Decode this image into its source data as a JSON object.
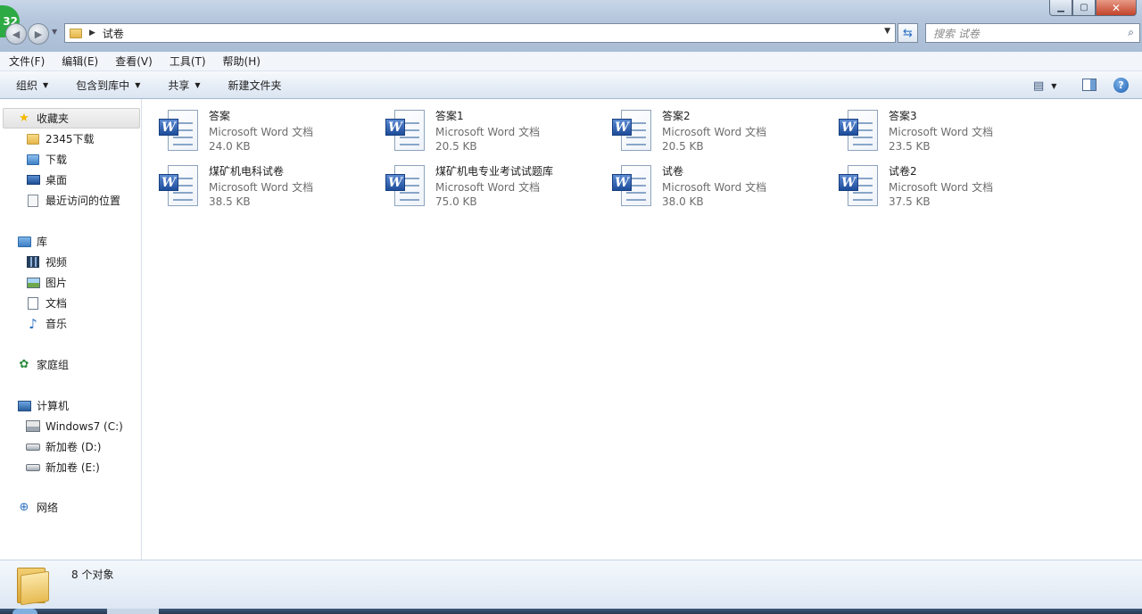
{
  "window": {
    "badge": "32",
    "address": {
      "current_folder": "试卷"
    },
    "search": {
      "placeholder": "搜索 试卷"
    },
    "controls": {
      "minimize": "▁",
      "maximize": "▢",
      "close": "✕"
    }
  },
  "menu": [
    {
      "label": "文件(F)"
    },
    {
      "label": "编辑(E)"
    },
    {
      "label": "查看(V)"
    },
    {
      "label": "工具(T)"
    },
    {
      "label": "帮助(H)"
    }
  ],
  "toolbar": {
    "organize": "组织",
    "include_in_library": "包含到库中",
    "share": "共享",
    "new_folder": "新建文件夹",
    "help": "?"
  },
  "nav": {
    "favorites": {
      "label": "收藏夹",
      "icon": "star-icon"
    },
    "favorites_items": [
      {
        "label": "2345下载",
        "icon": "folder-icon"
      },
      {
        "label": "下载",
        "icon": "downloads-folder-icon"
      },
      {
        "label": "桌面",
        "icon": "desktop-icon"
      },
      {
        "label": "最近访问的位置",
        "icon": "recent-places-icon"
      }
    ],
    "libraries": {
      "label": "库",
      "icon": "libraries-icon"
    },
    "library_items": [
      {
        "label": "视频",
        "icon": "video-library-icon"
      },
      {
        "label": "图片",
        "icon": "pictures-library-icon"
      },
      {
        "label": "文档",
        "icon": "documents-library-icon"
      },
      {
        "label": "音乐",
        "icon": "music-library-icon"
      }
    ],
    "homegroup": {
      "label": "家庭组",
      "icon": "homegroup-icon"
    },
    "computer": {
      "label": "计算机",
      "icon": "computer-icon"
    },
    "drives": [
      {
        "label": "Windows7 (C:)",
        "icon": "system-drive-icon"
      },
      {
        "label": "新加卷 (D:)",
        "icon": "drive-icon"
      },
      {
        "label": "新加卷 (E:)",
        "icon": "drive-icon"
      }
    ],
    "network": {
      "label": "网络",
      "icon": "network-icon"
    }
  },
  "files": [
    {
      "name": "答案",
      "type": "Microsoft Word 文档",
      "size": "24.0 KB"
    },
    {
      "name": "答案1",
      "type": "Microsoft Word 文档",
      "size": "20.5 KB"
    },
    {
      "name": "答案2",
      "type": "Microsoft Word 文档",
      "size": "20.5 KB"
    },
    {
      "name": "答案3",
      "type": "Microsoft Word 文档",
      "size": "23.5 KB"
    },
    {
      "name": "煤矿机电科试卷",
      "type": "Microsoft Word 文档",
      "size": "38.5 KB"
    },
    {
      "name": "煤矿机电专业考试试题库",
      "type": "Microsoft Word 文档",
      "size": "75.0 KB"
    },
    {
      "name": "试卷",
      "type": "Microsoft Word 文档",
      "size": "38.0 KB"
    },
    {
      "name": "试卷2",
      "type": "Microsoft Word 文档",
      "size": "37.5 KB"
    }
  ],
  "status": {
    "object_count": "8 个对象"
  },
  "colors": {
    "accent": "#2a6fc2",
    "close": "#c3432b",
    "badge": "#2eaa45"
  }
}
